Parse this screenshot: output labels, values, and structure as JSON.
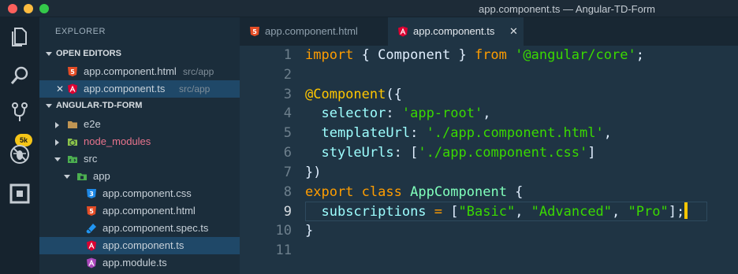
{
  "window": {
    "title": "app.component.ts — Angular-TD-Form"
  },
  "activity_bar": {
    "items": [
      {
        "icon": "files-icon"
      },
      {
        "icon": "search-icon"
      },
      {
        "icon": "source-control-icon",
        "badge": "5k"
      },
      {
        "icon": "debug-icon"
      },
      {
        "icon": "extensions-icon"
      }
    ]
  },
  "sidebar": {
    "title": "EXPLORER",
    "open_editors": {
      "header": "OPEN EDITORS",
      "items": [
        {
          "name": "app.component.html",
          "path": "src/app",
          "icon": "html5-icon"
        },
        {
          "name": "app.component.ts",
          "path": "src/app",
          "icon": "angular-icon",
          "close": "✕"
        }
      ]
    },
    "project": {
      "header": "ANGULAR-TD-FORM",
      "items": [
        {
          "name": "e2e"
        },
        {
          "name": "node_modules"
        },
        {
          "name": "src"
        },
        {
          "name": "app"
        },
        {
          "name": "app.component.css"
        },
        {
          "name": "app.component.html"
        },
        {
          "name": "app.component.spec.ts"
        },
        {
          "name": "app.component.ts"
        },
        {
          "name": "app.module.ts"
        }
      ]
    }
  },
  "tabs": [
    {
      "label": "app.component.html",
      "icon": "html5-icon",
      "active": false
    },
    {
      "label": "app.component.ts",
      "icon": "angular-icon",
      "active": true,
      "close": "✕"
    }
  ],
  "editor": {
    "line_numbers": [
      "1",
      "2",
      "3",
      "4",
      "5",
      "6",
      "7",
      "8",
      "9",
      "10",
      "11"
    ],
    "active_line": "9",
    "tokens": {
      "l1": [
        "import",
        " { Component } ",
        "from",
        " ",
        "'@angular/core'",
        ";"
      ],
      "l3": [
        "@Component",
        "({"
      ],
      "l4": [
        "  ",
        "selector",
        ": ",
        "'app-root'",
        ","
      ],
      "l5": [
        "  ",
        "templateUrl",
        ": ",
        "'./app.component.html'",
        ","
      ],
      "l6": [
        "  ",
        "styleUrls",
        ": [",
        "'./app.component.css'",
        "]"
      ],
      "l7": [
        "})"
      ],
      "l8": [
        "export",
        " ",
        "class",
        " ",
        "AppComponent",
        " {"
      ],
      "l9": [
        "  ",
        "subscriptions",
        " ",
        "=",
        " [",
        "\"Basic\"",
        ", ",
        "\"Advanced\"",
        ", ",
        "\"Pro\"",
        "];"
      ],
      "l10": [
        "}"
      ]
    }
  },
  "colors": {
    "keyword": "#ff9d00",
    "string": "#3ad900",
    "decorator": "#ffc600",
    "property": "#9effff",
    "class_name": "#80ffbb",
    "selection": "#1f4868"
  }
}
